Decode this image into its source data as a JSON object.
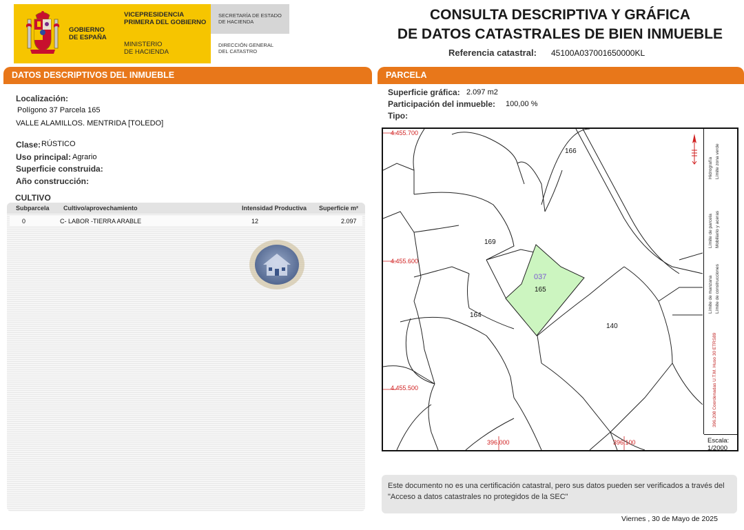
{
  "header": {
    "gov_name": "GOBIERNO\nDE ESPAÑA",
    "vicepresidencia": "VICEPRESIDENCIA\nPRIMERA DEL GOBIERNO",
    "ministerio": "MINISTERIO\nDE HACIENDA",
    "secretaria": "SECRETARÍA DE ESTADO\nDE HACIENDA",
    "direccion": "DIRECCIÓN GENERAL\nDEL CATASTRO",
    "title": "CONSULTA DESCRIPTIVA Y GRÁFICA\nDE DATOS CATASTRALES DE BIEN INMUEBLE",
    "ref_label": "Referencia catastral:",
    "ref_value": "45100A037001650000KL"
  },
  "left": {
    "section_title": "DATOS DESCRIPTIVOS DEL INMUEBLE",
    "localizacion_label": "Localización:",
    "loc_line1": "Polígono 37 Parcela 165",
    "loc_line2": "VALLE ALAMILLOS. MENTRIDA [TOLEDO]",
    "clase_label": "Clase:",
    "clase_value": "RÚSTICO",
    "uso_label": "Uso principal:",
    "uso_value": "Agrario",
    "sup_construida_label": "Superficie construida:",
    "anio_label": "Año construcción:",
    "cultivo_title": "CULTIVO",
    "table": {
      "headers": [
        "Subparcela",
        "Cultivo/aprovechamiento",
        "Intensidad Productiva",
        "Superficie m²"
      ],
      "rows": [
        [
          "0",
          "C- LABOR -TIERRA ARABLE",
          "12",
          "2.097"
        ]
      ]
    }
  },
  "right": {
    "section_title": "PARCELA",
    "sup_grafica_label": "Superficie gráfica:",
    "sup_grafica_value": "2.097 m2",
    "participacion_label": "Participación del inmueble:",
    "participacion_value": "100,00 %",
    "tipo_label": "Tipo:",
    "map": {
      "y_coords": [
        "4.455.700",
        "4.455.600",
        "4.455.500"
      ],
      "x_coords": [
        "396.000",
        "396.100"
      ],
      "parcels": [
        "166",
        "169",
        "164",
        "140",
        "165"
      ],
      "polygon_label": "037",
      "highlight_color": "#ccf5c0",
      "coord_color": "#d02020"
    },
    "legend": {
      "hidrografia": "Hidrografía",
      "zona_verde": "Límite zona verde",
      "parcela": "Límite de parcela",
      "mobiliario": "Mobiliario y aceras",
      "manzana": "Límite de manzana",
      "construcciones": "Límite de construcciones",
      "coordenadas": "396.208 Coordenadas U.T.M. Huso 30 ETRS89"
    },
    "scale_label": "Escala:",
    "scale_value": "1/2000",
    "notice": "Este documento no es una certificación catastral, pero sus datos pueden ser verificados a través del \"Acceso a datos catastrales no protegidos de la SEC\""
  },
  "footer": {
    "date": "Viernes , 30 de Mayo de 2025"
  },
  "colors": {
    "accent": "#e8771a",
    "gov_yellow": "#f6c500"
  }
}
